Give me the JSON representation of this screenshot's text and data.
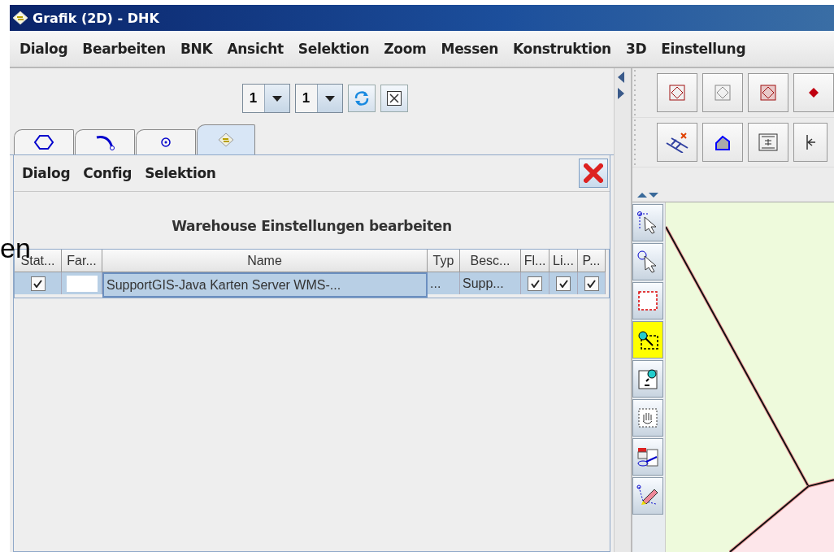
{
  "window": {
    "title": "Grafik (2D) - DHK"
  },
  "menu": [
    "Dialog",
    "Bearbeiten",
    "BNK",
    "Ansicht",
    "Selektion",
    "Zoom",
    "Messen",
    "Konstruktion",
    "3D",
    "Einstellung"
  ],
  "toolbar": {
    "combos": [
      {
        "value": "1"
      },
      {
        "value": "1"
      }
    ]
  },
  "tabs": [
    {
      "kind": "polygon",
      "selected": false
    },
    {
      "kind": "arc",
      "selected": false
    },
    {
      "kind": "point",
      "selected": false
    },
    {
      "kind": "warehouse",
      "selected": true
    }
  ],
  "panel": {
    "menu": [
      "Dialog",
      "Config",
      "Selektion"
    ],
    "heading": "Warehouse Einstellungen bearbeiten",
    "table": {
      "columns": [
        "Stat...",
        "Far...",
        "Name",
        "Typ",
        "Besc...",
        "Fl...",
        "Li...",
        "P..."
      ],
      "rows": [
        {
          "selected": true,
          "status": true,
          "name": "SupportGIS-Java Karten Server WMS-...",
          "type": "...",
          "description": "Supp...",
          "fl": true,
          "li": true,
          "p": true
        }
      ]
    }
  },
  "overlay_text": "en",
  "right_toolbar": [
    [
      {
        "kind": "diamond-red"
      },
      {
        "kind": "diamond-grey"
      },
      {
        "kind": "diamond-filled"
      },
      {
        "kind": "dot-red"
      }
    ],
    [
      {
        "kind": "ladder"
      },
      {
        "kind": "house"
      },
      {
        "kind": "align"
      },
      {
        "kind": "arrow-left"
      }
    ]
  ],
  "tools": [
    {
      "kind": "select-nodes",
      "selected": false
    },
    {
      "kind": "select-point",
      "selected": false
    },
    {
      "kind": "select-rect",
      "selected": false
    },
    {
      "kind": "zoom-rect",
      "selected": true
    },
    {
      "kind": "zoom-out",
      "selected": false
    },
    {
      "kind": "pan",
      "selected": false
    },
    {
      "kind": "transfer",
      "selected": false
    },
    {
      "kind": "edit",
      "selected": false
    }
  ]
}
